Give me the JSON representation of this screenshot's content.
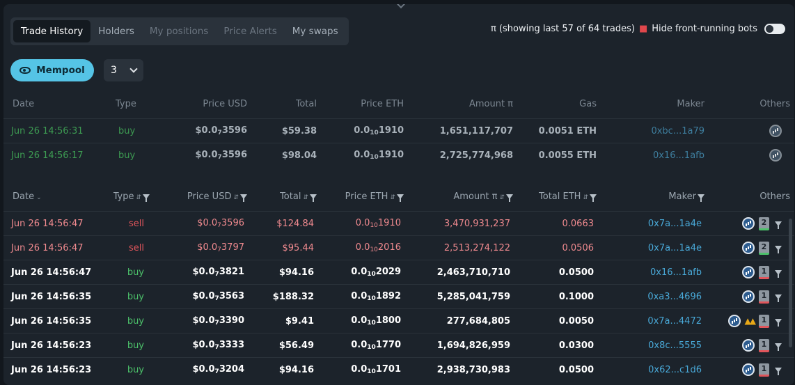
{
  "tabs": [
    {
      "label": "Trade History"
    },
    {
      "label": "Holders"
    },
    {
      "label": "My positions"
    },
    {
      "label": "Price Alerts"
    },
    {
      "label": "My swaps"
    }
  ],
  "showing_text": "π (showing last 57 of 64 trades)",
  "hide_bots_label": "Hide front-running bots",
  "mempool_label": "Mempool",
  "select_value": "3",
  "mempool_headers": [
    "Date",
    "Type",
    "Price USD",
    "Total",
    "Price ETH",
    "Amount π",
    "Gas",
    "Maker",
    "Others"
  ],
  "mempool_rows": [
    {
      "date": "Jun 26 14:56:31",
      "type": "buy",
      "price_usd_pre": "$0.0",
      "price_usd_sub": "7",
      "price_usd_post": "3596",
      "total": "$59.38",
      "price_eth_pre": "0.0",
      "price_eth_sub": "10",
      "price_eth_post": "1910",
      "amount": "1,651,117,707",
      "gas": "0.0051 ETH",
      "maker": "0xbc...1a79"
    },
    {
      "date": "Jun 26 14:56:17",
      "type": "buy",
      "price_usd_pre": "$0.0",
      "price_usd_sub": "7",
      "price_usd_post": "3596",
      "total": "$98.04",
      "price_eth_pre": "0.0",
      "price_eth_sub": "10",
      "price_eth_post": "1910",
      "amount": "2,725,774,968",
      "gas": "0.0055 ETH",
      "maker": "0x16...1afb"
    }
  ],
  "trade_headers": {
    "date": "Date",
    "type": "Type",
    "price_usd": "Price USD",
    "total": "Total",
    "price_eth": "Price ETH",
    "amount": "Amount π",
    "total_eth": "Total ETH",
    "maker": "Maker",
    "others": "Others"
  },
  "trades": [
    {
      "date": "Jun 26 14:56:47",
      "type": "sell",
      "price_usd_pre": "$0.0",
      "price_usd_sub": "7",
      "price_usd_post": "3596",
      "total": "$124.84",
      "price_eth_pre": "0.0",
      "price_eth_sub": "10",
      "price_eth_post": "1910",
      "amount": "3,470,931,237",
      "total_eth": "0.0663",
      "maker": "0x7a...1a4e",
      "badge": "2"
    },
    {
      "date": "Jun 26 14:56:47",
      "type": "sell",
      "price_usd_pre": "$0.0",
      "price_usd_sub": "7",
      "price_usd_post": "3797",
      "total": "$95.44",
      "price_eth_pre": "0.0",
      "price_eth_sub": "10",
      "price_eth_post": "2016",
      "amount": "2,513,274,122",
      "total_eth": "0.0506",
      "maker": "0x7a...1a4e",
      "badge": "2"
    },
    {
      "date": "Jun 26 14:56:47",
      "type": "buy",
      "price_usd_pre": "$0.0",
      "price_usd_sub": "7",
      "price_usd_post": "3821",
      "total": "$94.16",
      "price_eth_pre": "0.0",
      "price_eth_sub": "10",
      "price_eth_post": "2029",
      "amount": "2,463,710,710",
      "total_eth": "0.0500",
      "maker": "0x16...1afb",
      "badge": "1"
    },
    {
      "date": "Jun 26 14:56:35",
      "type": "buy",
      "price_usd_pre": "$0.0",
      "price_usd_sub": "7",
      "price_usd_post": "3563",
      "total": "$188.32",
      "price_eth_pre": "0.0",
      "price_eth_sub": "10",
      "price_eth_post": "1892",
      "amount": "5,285,041,759",
      "total_eth": "0.1000",
      "maker": "0xa3...4696",
      "badge": "1"
    },
    {
      "date": "Jun 26 14:56:35",
      "type": "buy",
      "price_usd_pre": "$0.0",
      "price_usd_sub": "7",
      "price_usd_post": "3390",
      "total": "$9.41",
      "price_eth_pre": "0.0",
      "price_eth_sub": "10",
      "price_eth_post": "1800",
      "amount": "277,684,805",
      "total_eth": "0.0050",
      "maker": "0x7a...4472",
      "badge": "1"
    },
    {
      "date": "Jun 26 14:56:23",
      "type": "buy",
      "price_usd_pre": "$0.0",
      "price_usd_sub": "7",
      "price_usd_post": "3333",
      "total": "$56.49",
      "price_eth_pre": "0.0",
      "price_eth_sub": "10",
      "price_eth_post": "1770",
      "amount": "1,694,826,959",
      "total_eth": "0.0300",
      "maker": "0x8c...5555",
      "badge": "1"
    },
    {
      "date": "Jun 26 14:56:23",
      "type": "buy",
      "price_usd_pre": "$0.0",
      "price_usd_sub": "7",
      "price_usd_post": "3204",
      "total": "$94.16",
      "price_eth_pre": "0.0",
      "price_eth_sub": "10",
      "price_eth_post": "1701",
      "amount": "2,938,730,983",
      "total_eth": "0.0500",
      "maker": "0x62...c1d6",
      "badge": "1"
    }
  ],
  "colors": {
    "buy": "#4cc16a",
    "sell": "#e0555b",
    "accent": "#55c4e6",
    "link": "#49a9d8"
  }
}
